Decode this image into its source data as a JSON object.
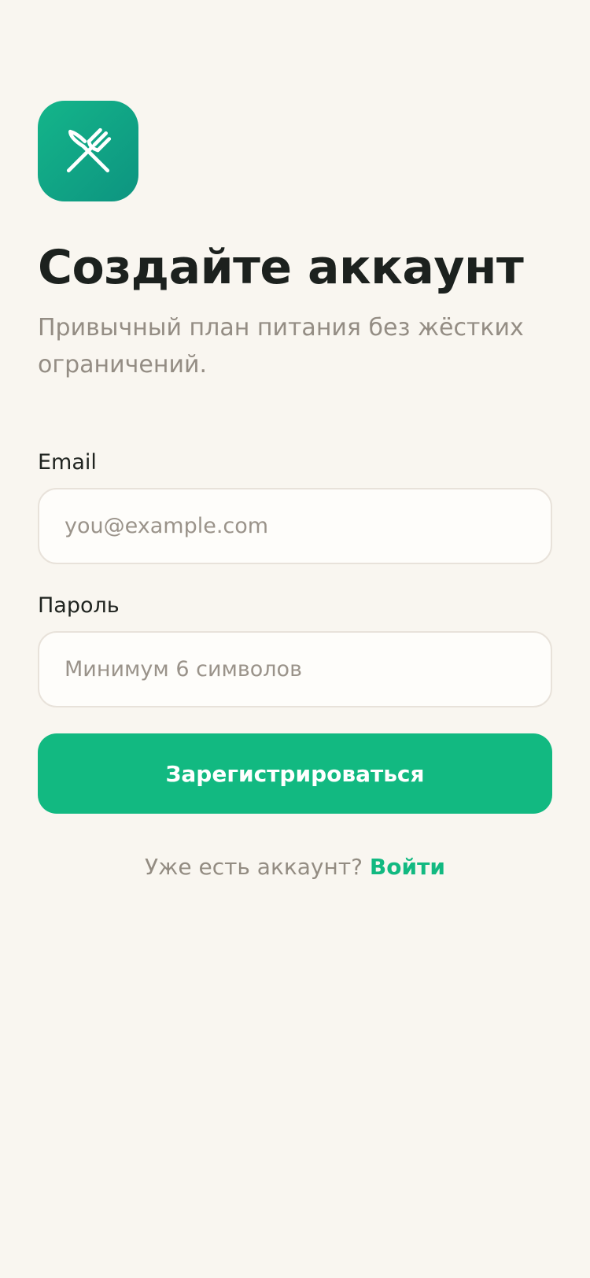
{
  "app": {
    "logo_icon": "utensils-crossed-icon",
    "accent_color": "#12b981"
  },
  "header": {
    "title": "Создайте аккаунт",
    "subtitle": "Привычный план питания без жёстких ограничений."
  },
  "form": {
    "email": {
      "label": "Email",
      "value": "",
      "placeholder": "you@example.com"
    },
    "password": {
      "label": "Пароль",
      "value": "",
      "placeholder": "Минимум 6 символов"
    },
    "submit_label": "Зарегистрироваться"
  },
  "footer": {
    "prompt": "Уже есть аккаунт?",
    "login_link": "Войти"
  }
}
